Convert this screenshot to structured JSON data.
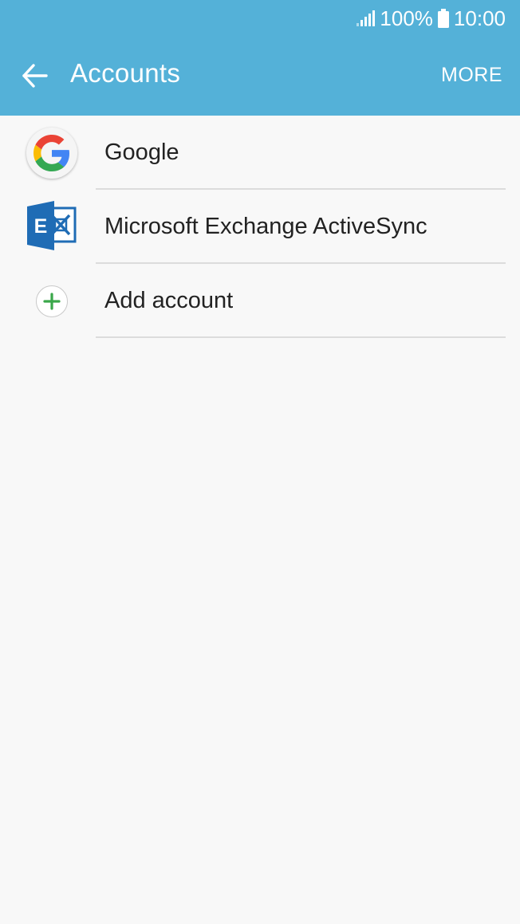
{
  "status_bar": {
    "battery_percent": "100%",
    "time": "10:00",
    "signal_icon": "signal-icon",
    "battery_icon": "battery-icon"
  },
  "toolbar": {
    "title": "Accounts",
    "more_label": "MORE",
    "back_icon": "back-arrow-icon"
  },
  "accounts": [
    {
      "label": "Google",
      "icon": "google-icon"
    },
    {
      "label": "Microsoft Exchange ActiveSync",
      "icon": "exchange-icon"
    },
    {
      "label": "Add account",
      "icon": "add-icon"
    }
  ],
  "colors": {
    "header": "#54b1d8",
    "background": "#f8f8f8",
    "divider": "#dcdcdc",
    "add_accent": "#3aa74a",
    "exchange_blue": "#1f6cb5"
  }
}
